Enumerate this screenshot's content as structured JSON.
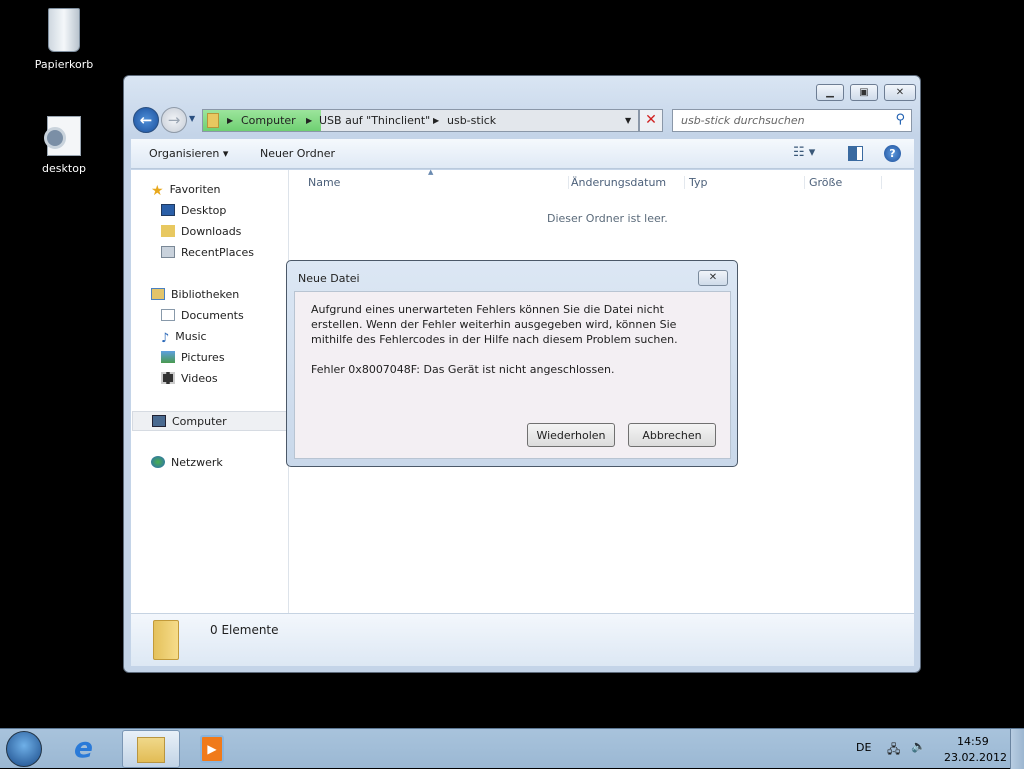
{
  "desktop": {
    "icons": [
      {
        "label": "Papierkorb"
      },
      {
        "label": "desktop"
      }
    ]
  },
  "explorer": {
    "breadcrumb": [
      "Computer",
      "USB auf \"Thinclient\"",
      "usb-stick"
    ],
    "search_placeholder": "usb-stick durchsuchen",
    "toolbar": {
      "organize": "Organisieren",
      "new_folder": "Neuer Ordner"
    },
    "nav": {
      "favorites": "Favoriten",
      "favorites_items": [
        "Desktop",
        "Downloads",
        "RecentPlaces"
      ],
      "libraries": "Bibliotheken",
      "libraries_items": [
        "Documents",
        "Music",
        "Pictures",
        "Videos"
      ],
      "computer": "Computer",
      "network": "Netzwerk"
    },
    "columns": [
      "Name",
      "Änderungsdatum",
      "Typ",
      "Größe"
    ],
    "empty_message": "Dieser Ordner ist leer.",
    "details": {
      "count": "0 Elemente"
    }
  },
  "dialog": {
    "title": "Neue Datei",
    "message": "Aufgrund eines unerwarteten Fehlers können Sie die Datei nicht erstellen. Wenn der Fehler weiterhin ausgegeben wird, können Sie mithilfe des Fehlercodes in der Hilfe nach diesem Problem suchen.",
    "error": "Fehler 0x8007048F: Das Gerät ist nicht angeschlossen.",
    "retry": "Wiederholen",
    "cancel": "Abbrechen"
  },
  "taskbar": {
    "language": "DE",
    "time": "14:59",
    "date": "23.02.2012"
  }
}
